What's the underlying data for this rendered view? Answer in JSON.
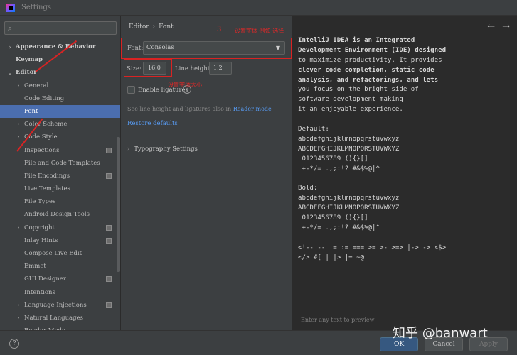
{
  "window": {
    "title": "Settings",
    "app_icon": "intellij-idea-icon"
  },
  "sidebar": {
    "search_placeholder": "",
    "items": [
      {
        "label": "Appearance & Behavior",
        "level": 0,
        "expandable": true,
        "expanded": false,
        "bold": true
      },
      {
        "label": "Keymap",
        "level": 0,
        "expandable": false,
        "bold": true
      },
      {
        "label": "Editor",
        "level": 0,
        "expandable": true,
        "expanded": true,
        "bold": true
      },
      {
        "label": "General",
        "level": 1,
        "expandable": true,
        "expanded": false
      },
      {
        "label": "Code Editing",
        "level": 1,
        "expandable": false
      },
      {
        "label": "Font",
        "level": 1,
        "expandable": false,
        "selected": true
      },
      {
        "label": "Color Scheme",
        "level": 1,
        "expandable": true,
        "expanded": false
      },
      {
        "label": "Code Style",
        "level": 1,
        "expandable": true,
        "expanded": false
      },
      {
        "label": "Inspections",
        "level": 1,
        "expandable": false,
        "project_icon": true
      },
      {
        "label": "File and Code Templates",
        "level": 1,
        "expandable": false
      },
      {
        "label": "File Encodings",
        "level": 1,
        "expandable": false,
        "project_icon": true
      },
      {
        "label": "Live Templates",
        "level": 1,
        "expandable": false
      },
      {
        "label": "File Types",
        "level": 1,
        "expandable": false
      },
      {
        "label": "Android Design Tools",
        "level": 1,
        "expandable": false
      },
      {
        "label": "Copyright",
        "level": 1,
        "expandable": true,
        "expanded": false,
        "project_icon": true
      },
      {
        "label": "Inlay Hints",
        "level": 1,
        "expandable": false,
        "project_icon": true
      },
      {
        "label": "Compose Live Edit",
        "level": 1,
        "expandable": false
      },
      {
        "label": "Emmet",
        "level": 1,
        "expandable": false
      },
      {
        "label": "GUI Designer",
        "level": 1,
        "expandable": false,
        "project_icon": true
      },
      {
        "label": "Intentions",
        "level": 1,
        "expandable": false
      },
      {
        "label": "Language Injections",
        "level": 1,
        "expandable": true,
        "expanded": false,
        "project_icon": true
      },
      {
        "label": "Natural Languages",
        "level": 1,
        "expandable": true,
        "expanded": false
      },
      {
        "label": "Reader Mode",
        "level": 1,
        "expandable": false
      }
    ]
  },
  "content": {
    "breadcrumb": [
      "Editor",
      "Font"
    ],
    "font_label": "Font:",
    "font_value": "Consolas",
    "size_label": "Size:",
    "size_value": "16.0",
    "line_height_label": "Line height:",
    "line_height_value": "1.2",
    "ligatures_label": "Enable ligatures",
    "ligatures_checked": false,
    "hint_prefix": "See line height and ligatures also in",
    "hint_link": "Reader mode",
    "restore_defaults": "Restore defaults",
    "typography": "Typography Settings"
  },
  "preview": {
    "lines": [
      "IntelliJ IDEA is an Integrated",
      "Development Environment (IDE) designed",
      "to maximize productivity. It provides",
      "clever code completion, static code",
      "analysis, and refactorings, and lets",
      "you focus on the bright side of",
      "software development making",
      "it an enjoyable experience.",
      "",
      "Default:",
      "abcdefghijklmnopqrstuvwxyz",
      "ABCDEFGHIJKLMNOPQRSTUVWXYZ",
      " 0123456789 (){}[]",
      " +-*/= .,;:!? #&$%@|^",
      "",
      "Bold:",
      "abcdefghijklmnopqrstuvwxyz",
      "ABCDEFGHIJKLMNOPQRSTUVWXYZ",
      " 0123456789 (){}[]",
      " +-*/= .,;:!? #&$%@|^",
      "",
      "<!-- -- != := === >= >- >=> |-> -> <$>",
      "</> #[ |||> |= ~@"
    ],
    "bold_lines": [
      0,
      1,
      3,
      4
    ],
    "placeholder": "Enter any text to preview"
  },
  "footer": {
    "help": "?",
    "ok": "OK",
    "cancel": "Cancel",
    "apply": "Apply"
  },
  "annotations": {
    "step3_number": "3",
    "font_note": "设置字体  例如  选择",
    "size_note": "设置字体大小",
    "color": "#d92323"
  },
  "watermark": "知乎 @banwart"
}
